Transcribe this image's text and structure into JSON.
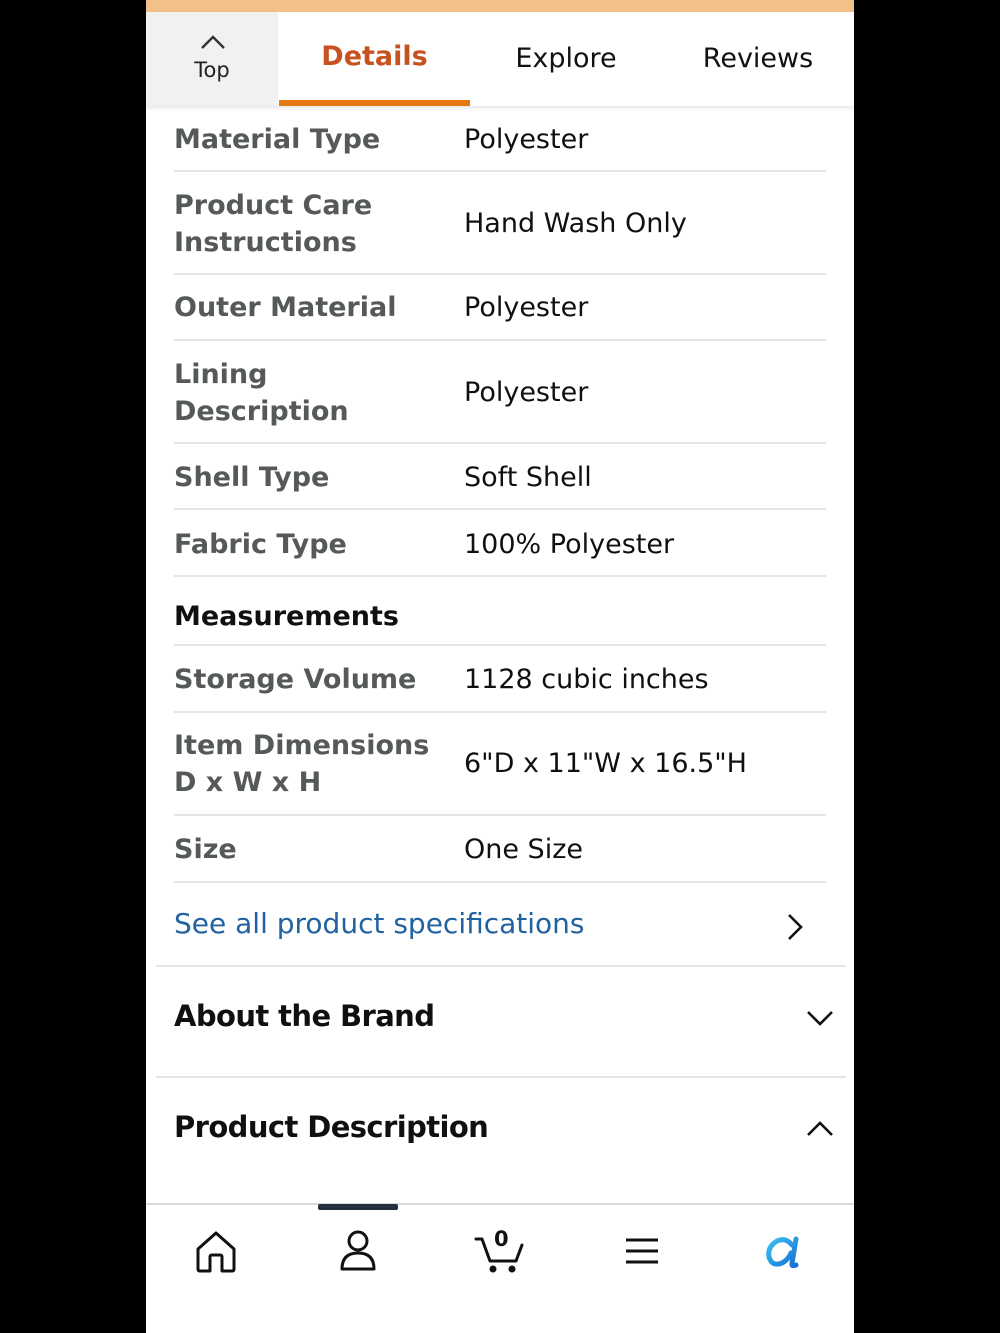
{
  "tabs": {
    "top_label": "Top",
    "items": [
      {
        "label": "Details"
      },
      {
        "label": "Explore"
      },
      {
        "label": "Reviews"
      }
    ]
  },
  "specs": [
    {
      "key": "Material Type",
      "value": "Polyester"
    },
    {
      "key_lines": [
        "Product Care",
        "Instructions"
      ],
      "value": "Hand Wash Only"
    },
    {
      "key": "Outer Material",
      "value": "Polyester"
    },
    {
      "key_lines": [
        "Lining",
        "Description"
      ],
      "value": "Polyester"
    },
    {
      "key": "Shell Type",
      "value": "Soft Shell"
    },
    {
      "key": "Fabric Type",
      "value": "100% Polyester"
    }
  ],
  "measurements": {
    "title": "Measurements",
    "rows": [
      {
        "key": "Storage Volume",
        "value": "1128 cubic inches"
      },
      {
        "key_lines": [
          "Item Dimensions",
          "D x W x H"
        ],
        "value": "6\"D x 11\"W x 16.5\"H"
      },
      {
        "key": "Size",
        "value": "One Size"
      }
    ]
  },
  "see_all": {
    "label": "See all product specifications"
  },
  "sections": {
    "about_brand": "About the Brand",
    "product_description": "Product Description"
  },
  "bottom_nav": {
    "cart_count": "0",
    "items": [
      "home-icon",
      "account-icon",
      "cart-icon",
      "menu-icon",
      "alexa-icon"
    ]
  },
  "colors": {
    "accent_orange": "#e47911",
    "active_tab_text": "#c7511f",
    "link_blue": "#2162a1",
    "alexa_blue": "#1aa3e8"
  }
}
